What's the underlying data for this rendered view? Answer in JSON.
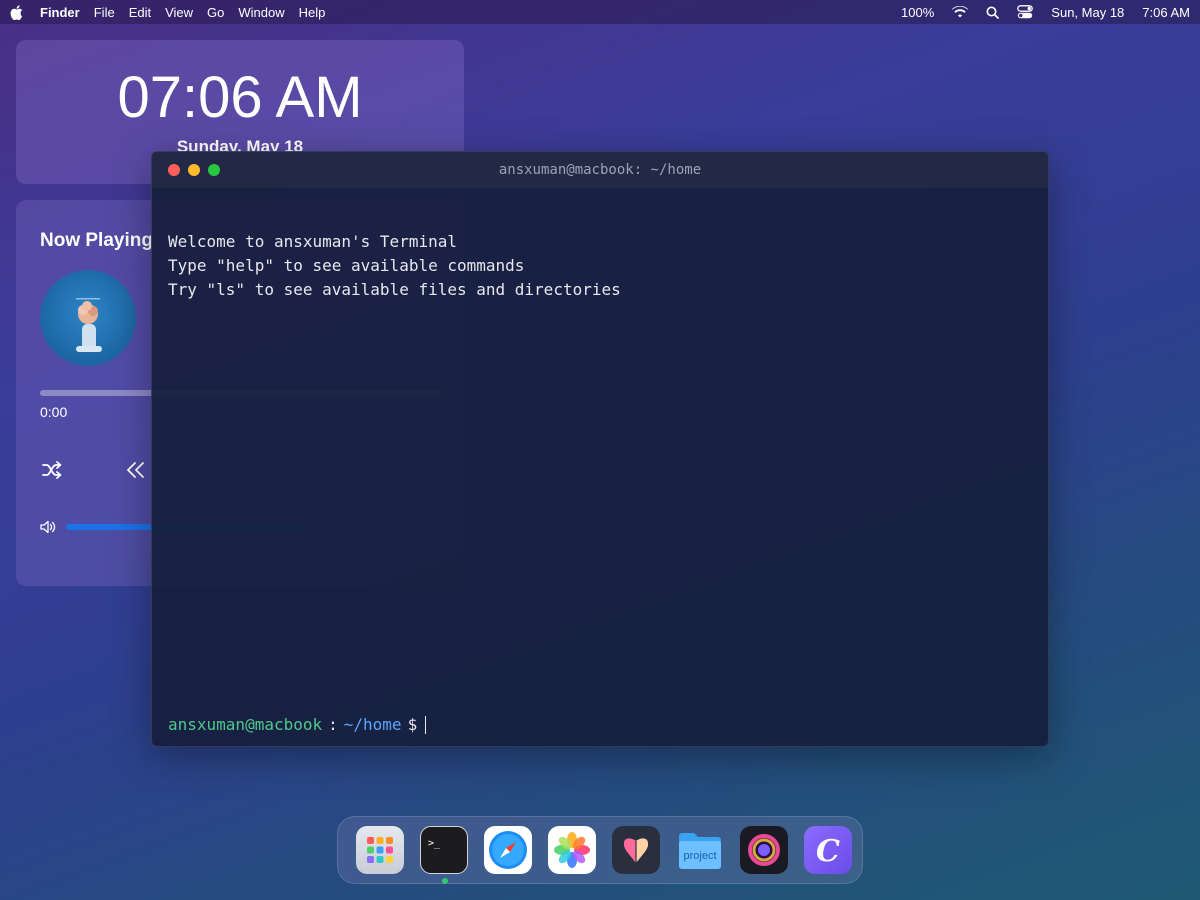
{
  "menubar": {
    "app_name": "Finder",
    "menus": [
      "File",
      "Edit",
      "View",
      "Go",
      "Window",
      "Help"
    ],
    "battery": "100%",
    "date": "Sun, May 18",
    "time": "7:06 AM",
    "icons": [
      "apple-icon",
      "wifi-icon",
      "search-icon",
      "control-center-icon"
    ]
  },
  "clock_widget": {
    "time": "07:06 AM",
    "date": "Sunday, May 18"
  },
  "music_widget": {
    "title": "Now Playing",
    "elapsed": "0:00",
    "progress": 0,
    "icons": [
      "album-art",
      "shuffle-icon",
      "previous-icon",
      "volume-icon"
    ]
  },
  "terminal": {
    "title": "ansxuman@macbook: ~/home",
    "lines": [
      "Welcome to ansxuman's Terminal",
      "Type \"help\" to see available commands",
      "Try \"ls\" to see available files and directories"
    ],
    "prompt": {
      "user": "ansxuman@macbook",
      "separator": ":",
      "path": "~/home",
      "symbol": "$"
    }
  },
  "dock": {
    "items": [
      {
        "name": "launchpad",
        "running": false
      },
      {
        "name": "terminal",
        "running": true
      },
      {
        "name": "safari",
        "running": false
      },
      {
        "name": "photos",
        "running": false
      },
      {
        "name": "butterfly-app",
        "running": false
      },
      {
        "name": "project-folder",
        "running": false,
        "label": "project"
      },
      {
        "name": "siri",
        "running": false
      },
      {
        "name": "c-app",
        "running": false,
        "label": "C"
      }
    ]
  },
  "colors": {
    "prompt_user": "#4fc98a",
    "prompt_path": "#5aa6ff",
    "volume_bar": "#1a73e8"
  }
}
